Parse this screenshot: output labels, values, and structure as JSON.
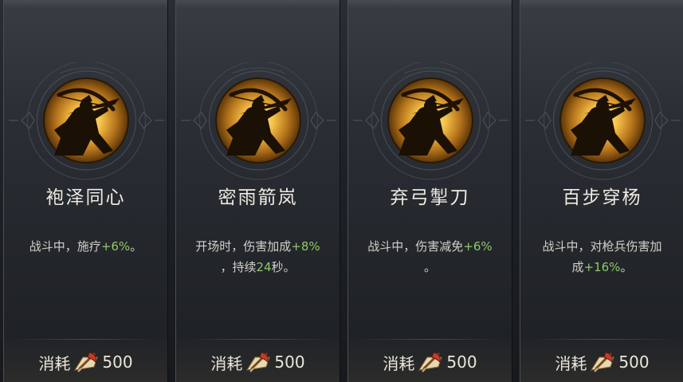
{
  "cards": [
    {
      "name": "袍泽同心",
      "desc_line1_pre": "战斗中，施疗",
      "desc_line1_hl": "+6%",
      "desc_line1_post": "。",
      "desc_line2_pre": "",
      "desc_line2_hl": "",
      "desc_line2_post": "",
      "icon": "archer-icon",
      "cost_label": "消耗",
      "cost_icon": "axe-icon",
      "cost_value": "500"
    },
    {
      "name": "密雨箭岚",
      "desc_line1_pre": "开场时，伤害加成",
      "desc_line1_hl": "+8%",
      "desc_line1_post": "",
      "desc_line2_pre": "，持续",
      "desc_line2_hl": "24",
      "desc_line2_post": "秒。",
      "icon": "archer-icon",
      "cost_label": "消耗",
      "cost_icon": "axe-icon",
      "cost_value": "500"
    },
    {
      "name": "弃弓掣刀",
      "desc_line1_pre": "战斗中，伤害减免",
      "desc_line1_hl": "+6%",
      "desc_line1_post": "",
      "desc_line2_pre": "。",
      "desc_line2_hl": "",
      "desc_line2_post": "",
      "icon": "archer-icon",
      "cost_label": "消耗",
      "cost_icon": "axe-icon",
      "cost_value": "500"
    },
    {
      "name": "百步穿杨",
      "desc_line1_pre": "战斗中，对枪兵伤害加",
      "desc_line1_hl": "",
      "desc_line1_post": "",
      "desc_line2_pre": "成",
      "desc_line2_hl": "+16%",
      "desc_line2_post": "。",
      "icon": "archer-icon",
      "cost_label": "消耗",
      "cost_icon": "axe-icon",
      "cost_value": "500"
    }
  ],
  "colors": {
    "highlight": "#8fc86a",
    "gold": "#f2b63c"
  }
}
